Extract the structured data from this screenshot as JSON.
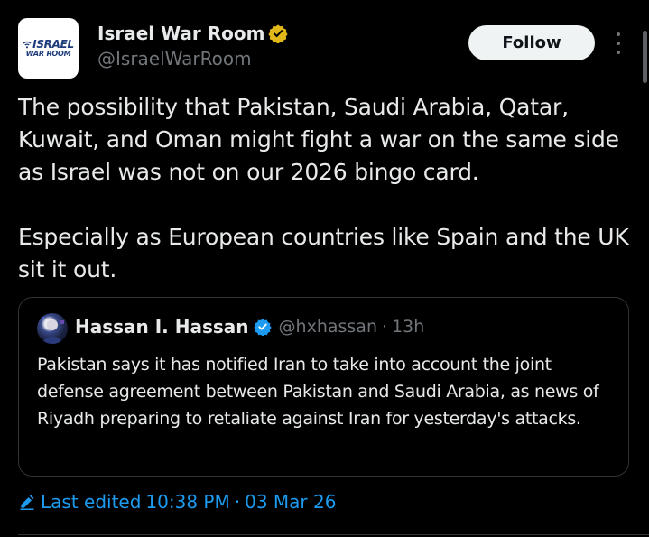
{
  "author": {
    "display_name": "Israel War Room",
    "handle": "@IsraelWarRoom",
    "logo_line1": "ISRAEL",
    "logo_line2": "WAR ROOM",
    "verified_badge": "gold-check-icon"
  },
  "actions": {
    "follow_label": "Follow",
    "more_icon": "more-vertical-icon"
  },
  "tweet": {
    "text": "The possibility that Pakistan, Saudi Arabia, Qatar, Kuwait, and Oman might fight a war on the same side as Israel was not on our 2026 bingo card.\n\nEspecially as European countries like Spain and the UK sit it out."
  },
  "quoted_tweet": {
    "display_name": "Hassan I. Hassan",
    "verified_badge": "blue-check-icon",
    "handle": "@hxhassan",
    "separator": "·",
    "time": "13h",
    "text": "Pakistan says it has notified Iran to take into account the joint defense agreement between Pakistan and Saudi Arabia, as news of Riyadh preparing to retaliate against Iran for yesterday's attacks."
  },
  "edit_info": {
    "icon": "pencil-icon",
    "label": "Last edited",
    "time": "10:38 PM",
    "separator": "·",
    "date": "03 Mar 26"
  },
  "colors": {
    "background": "#000000",
    "text_primary": "#e7e9ea",
    "text_secondary": "#71767b",
    "accent": "#1d9bf0",
    "gold_badge": "#e2b719",
    "border": "#2f3336",
    "follow_bg": "#eff3f4"
  }
}
